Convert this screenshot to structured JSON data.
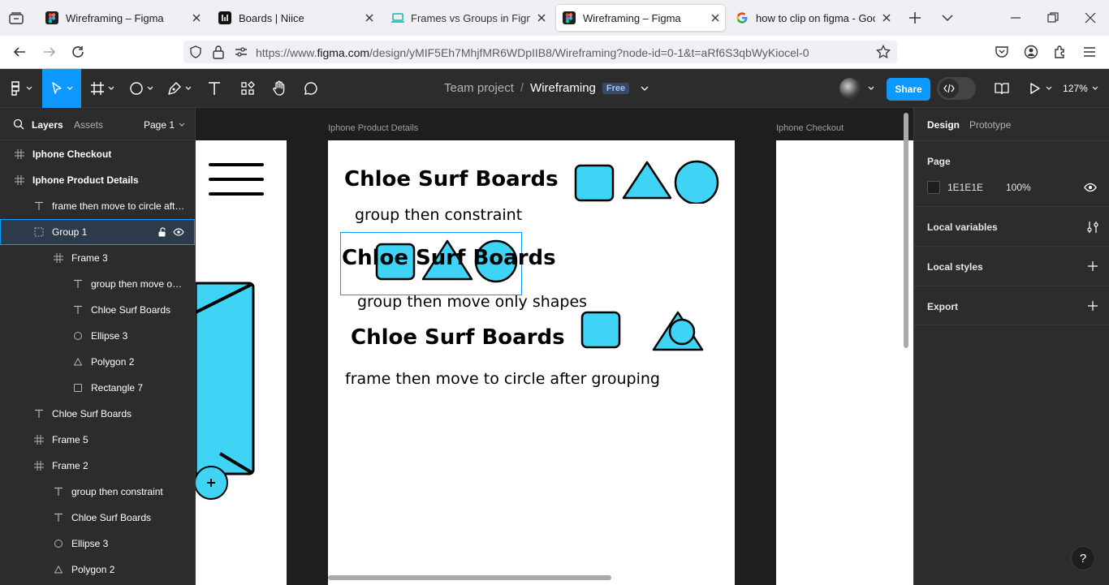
{
  "browser": {
    "tabs": [
      {
        "title": "Wireframing – Figma",
        "active": false
      },
      {
        "title": "Boards | Niice",
        "active": false
      },
      {
        "title": "Frames vs Groups in Figma | E",
        "active": false
      },
      {
        "title": "Wireframing – Figma",
        "active": true
      },
      {
        "title": "how to clip on figma - Googl",
        "active": false
      }
    ],
    "url_prefix": "https://www.",
    "url_host": "figma.com",
    "url_path": "/design/yMIF5Eh7MhjfMR6WDpIIB8/Wireframing?node-id=0-1&t=aRf6S3qbWyKiocel-0"
  },
  "figma": {
    "breadcrumb": {
      "team": "Team project",
      "separator": "/",
      "file": "Wireframing",
      "badge": "Free"
    },
    "share_label": "Share",
    "zoom": "127%",
    "left_panel": {
      "tabs": {
        "layers": "Layers",
        "assets": "Assets"
      },
      "page": "Page 1",
      "layers": [
        {
          "name": "Iphone Checkout",
          "type": "frame",
          "depth": 0,
          "bold": true
        },
        {
          "name": "Iphone Product Details",
          "type": "frame",
          "depth": 0,
          "bold": true
        },
        {
          "name": "frame then move to circle afte...",
          "type": "text",
          "depth": 1
        },
        {
          "name": "Group 1",
          "type": "group",
          "depth": 1,
          "selected": true
        },
        {
          "name": "Frame 3",
          "type": "frame",
          "depth": 2
        },
        {
          "name": "group then move onl...",
          "type": "text",
          "depth": 3
        },
        {
          "name": "Chloe Surf Boards",
          "type": "text",
          "depth": 3
        },
        {
          "name": "Ellipse 3",
          "type": "ellipse",
          "depth": 3
        },
        {
          "name": "Polygon 2",
          "type": "polygon",
          "depth": 3
        },
        {
          "name": "Rectangle 7",
          "type": "rect",
          "depth": 3
        },
        {
          "name": "Chloe Surf Boards",
          "type": "text",
          "depth": 1
        },
        {
          "name": "Frame 5",
          "type": "frame",
          "depth": 1
        },
        {
          "name": "Frame 2",
          "type": "frame",
          "depth": 1
        },
        {
          "name": "group then constraint",
          "type": "text",
          "depth": 2
        },
        {
          "name": "Chloe Surf Boards",
          "type": "text",
          "depth": 2
        },
        {
          "name": "Ellipse 3",
          "type": "ellipse",
          "depth": 2
        },
        {
          "name": "Polygon 2",
          "type": "polygon",
          "depth": 2
        }
      ]
    },
    "canvas": {
      "frame_labels": {
        "product": "Iphone Product Details",
        "checkout": "Iphone Checkout"
      },
      "texts": {
        "title1": "Chloe Surf Boards",
        "sub1": "group then constraint",
        "title2": "Chloe Surf Boards",
        "sub2": "group then move only shapes",
        "title3": "Chloe Surf Boards",
        "sub3": "frame then move to circle after grouping"
      },
      "shape_fill": "#3fd4f5",
      "selection_color": "#0d99ff"
    },
    "right_panel": {
      "tabs": {
        "design": "Design",
        "prototype": "Prototype"
      },
      "page_heading": "Page",
      "page_color": "1E1E1E",
      "page_opacity": "100%",
      "sections": [
        "Local variables",
        "Local styles",
        "Export"
      ]
    }
  }
}
